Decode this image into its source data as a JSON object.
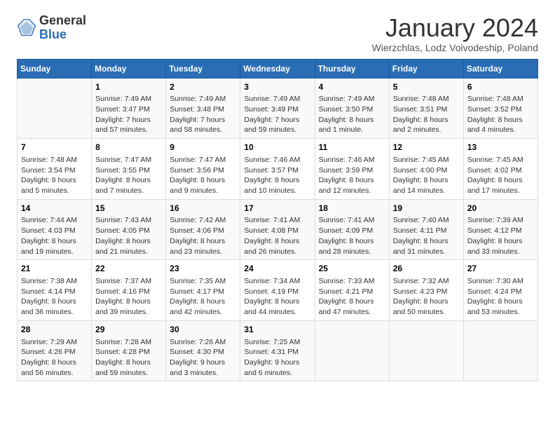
{
  "header": {
    "logo_general": "General",
    "logo_blue": "Blue",
    "month_title": "January 2024",
    "subtitle": "Wierzchlas, Lodz Voivodeship, Poland"
  },
  "days_of_week": [
    "Sunday",
    "Monday",
    "Tuesday",
    "Wednesday",
    "Thursday",
    "Friday",
    "Saturday"
  ],
  "weeks": [
    [
      {
        "day": "",
        "info": ""
      },
      {
        "day": "1",
        "info": "Sunrise: 7:49 AM\nSunset: 3:47 PM\nDaylight: 7 hours\nand 57 minutes."
      },
      {
        "day": "2",
        "info": "Sunrise: 7:49 AM\nSunset: 3:48 PM\nDaylight: 7 hours\nand 58 minutes."
      },
      {
        "day": "3",
        "info": "Sunrise: 7:49 AM\nSunset: 3:49 PM\nDaylight: 7 hours\nand 59 minutes."
      },
      {
        "day": "4",
        "info": "Sunrise: 7:49 AM\nSunset: 3:50 PM\nDaylight: 8 hours\nand 1 minute."
      },
      {
        "day": "5",
        "info": "Sunrise: 7:48 AM\nSunset: 3:51 PM\nDaylight: 8 hours\nand 2 minutes."
      },
      {
        "day": "6",
        "info": "Sunrise: 7:48 AM\nSunset: 3:52 PM\nDaylight: 8 hours\nand 4 minutes."
      }
    ],
    [
      {
        "day": "7",
        "info": "Sunrise: 7:48 AM\nSunset: 3:54 PM\nDaylight: 8 hours\nand 5 minutes."
      },
      {
        "day": "8",
        "info": "Sunrise: 7:47 AM\nSunset: 3:55 PM\nDaylight: 8 hours\nand 7 minutes."
      },
      {
        "day": "9",
        "info": "Sunrise: 7:47 AM\nSunset: 3:56 PM\nDaylight: 8 hours\nand 9 minutes."
      },
      {
        "day": "10",
        "info": "Sunrise: 7:46 AM\nSunset: 3:57 PM\nDaylight: 8 hours\nand 10 minutes."
      },
      {
        "day": "11",
        "info": "Sunrise: 7:46 AM\nSunset: 3:59 PM\nDaylight: 8 hours\nand 12 minutes."
      },
      {
        "day": "12",
        "info": "Sunrise: 7:45 AM\nSunset: 4:00 PM\nDaylight: 8 hours\nand 14 minutes."
      },
      {
        "day": "13",
        "info": "Sunrise: 7:45 AM\nSunset: 4:02 PM\nDaylight: 8 hours\nand 17 minutes."
      }
    ],
    [
      {
        "day": "14",
        "info": "Sunrise: 7:44 AM\nSunset: 4:03 PM\nDaylight: 8 hours\nand 19 minutes."
      },
      {
        "day": "15",
        "info": "Sunrise: 7:43 AM\nSunset: 4:05 PM\nDaylight: 8 hours\nand 21 minutes."
      },
      {
        "day": "16",
        "info": "Sunrise: 7:42 AM\nSunset: 4:06 PM\nDaylight: 8 hours\nand 23 minutes."
      },
      {
        "day": "17",
        "info": "Sunrise: 7:41 AM\nSunset: 4:08 PM\nDaylight: 8 hours\nand 26 minutes."
      },
      {
        "day": "18",
        "info": "Sunrise: 7:41 AM\nSunset: 4:09 PM\nDaylight: 8 hours\nand 28 minutes."
      },
      {
        "day": "19",
        "info": "Sunrise: 7:40 AM\nSunset: 4:11 PM\nDaylight: 8 hours\nand 31 minutes."
      },
      {
        "day": "20",
        "info": "Sunrise: 7:39 AM\nSunset: 4:12 PM\nDaylight: 8 hours\nand 33 minutes."
      }
    ],
    [
      {
        "day": "21",
        "info": "Sunrise: 7:38 AM\nSunset: 4:14 PM\nDaylight: 8 hours\nand 36 minutes."
      },
      {
        "day": "22",
        "info": "Sunrise: 7:37 AM\nSunset: 4:16 PM\nDaylight: 8 hours\nand 39 minutes."
      },
      {
        "day": "23",
        "info": "Sunrise: 7:35 AM\nSunset: 4:17 PM\nDaylight: 8 hours\nand 42 minutes."
      },
      {
        "day": "24",
        "info": "Sunrise: 7:34 AM\nSunset: 4:19 PM\nDaylight: 8 hours\nand 44 minutes."
      },
      {
        "day": "25",
        "info": "Sunrise: 7:33 AM\nSunset: 4:21 PM\nDaylight: 8 hours\nand 47 minutes."
      },
      {
        "day": "26",
        "info": "Sunrise: 7:32 AM\nSunset: 4:23 PM\nDaylight: 8 hours\nand 50 minutes."
      },
      {
        "day": "27",
        "info": "Sunrise: 7:30 AM\nSunset: 4:24 PM\nDaylight: 8 hours\nand 53 minutes."
      }
    ],
    [
      {
        "day": "28",
        "info": "Sunrise: 7:29 AM\nSunset: 4:26 PM\nDaylight: 8 hours\nand 56 minutes."
      },
      {
        "day": "29",
        "info": "Sunrise: 7:28 AM\nSunset: 4:28 PM\nDaylight: 8 hours\nand 59 minutes."
      },
      {
        "day": "30",
        "info": "Sunrise: 7:26 AM\nSunset: 4:30 PM\nDaylight: 9 hours\nand 3 minutes."
      },
      {
        "day": "31",
        "info": "Sunrise: 7:25 AM\nSunset: 4:31 PM\nDaylight: 9 hours\nand 6 minutes."
      },
      {
        "day": "",
        "info": ""
      },
      {
        "day": "",
        "info": ""
      },
      {
        "day": "",
        "info": ""
      }
    ]
  ]
}
